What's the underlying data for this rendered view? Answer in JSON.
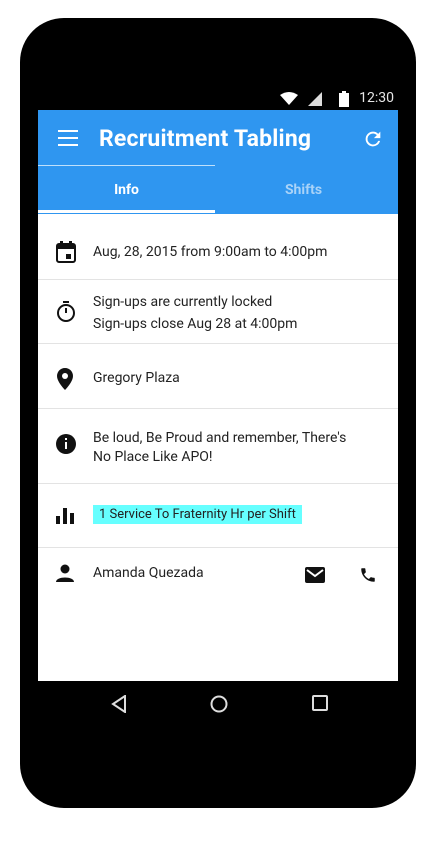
{
  "status_bar": {
    "time": "12:30"
  },
  "app_bar": {
    "title": "Recruitment Tabling"
  },
  "tabs": [
    {
      "label": "Info",
      "active": true
    },
    {
      "label": "Shifts",
      "active": false
    }
  ],
  "items": {
    "date": {
      "text": "Aug, 28, 2015 from 9:00am to 4:00pm",
      "icon": "calendar-icon"
    },
    "signup": {
      "text": "Sign-ups are currently locked",
      "subtext": "Sign-ups close Aug 28 at 4:00pm",
      "icon": "timer-icon"
    },
    "location": {
      "text": "Gregory Plaza",
      "icon": "location-pin-icon"
    },
    "description": {
      "text_line1": "Be loud, Be Proud and remember, There's",
      "text_line2": "No Place Like APO!",
      "icon": "info-icon"
    },
    "service": {
      "text": "1 Service To Fraternity Hr per Shift",
      "icon": "bar-chart-icon"
    },
    "contact": {
      "text": "Amanda Quezada",
      "icon": "person-icon"
    }
  },
  "colors": {
    "accent": "#2f96f0",
    "highlight": "#66ffff"
  }
}
